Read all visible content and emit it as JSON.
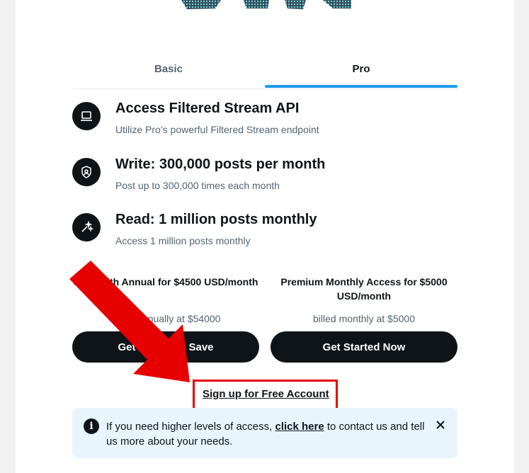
{
  "tabs": [
    {
      "label": "Basic",
      "active": false
    },
    {
      "label": "Pro",
      "active": true
    }
  ],
  "features": [
    {
      "icon": "laptop-icon",
      "title": "Access Filtered Stream API",
      "description": "Utilize Pro’s powerful Filtered Stream endpoint"
    },
    {
      "icon": "shield-user-icon",
      "title": "Write: 300,000 posts per month",
      "description": "Post up to 300,000 times each month"
    },
    {
      "icon": "sparkle-wand-icon",
      "title": "Read: 1 million posts monthly",
      "description": "Access 1 million posts monthly"
    }
  ],
  "plans": {
    "annual": {
      "title": "Save with Annual for $4500 USD/month",
      "billing": "billed annually at $54000",
      "button": "Get Started & Save"
    },
    "monthly": {
      "title": "Premium Monthly Access for $5000 USD/month",
      "billing": "billed monthly at $5000",
      "button": "Get Started Now"
    }
  },
  "signup": {
    "label": "Sign up for Free Account"
  },
  "notice": {
    "text_before": "If you need higher levels of access, ",
    "link": "click here",
    "text_after": " to contact us and tell us more about your needs."
  },
  "colors": {
    "accent": "#1d9bf0",
    "button": "#0f1419",
    "annotation": "#e60000",
    "notice_bg": "#e8f5fd"
  }
}
